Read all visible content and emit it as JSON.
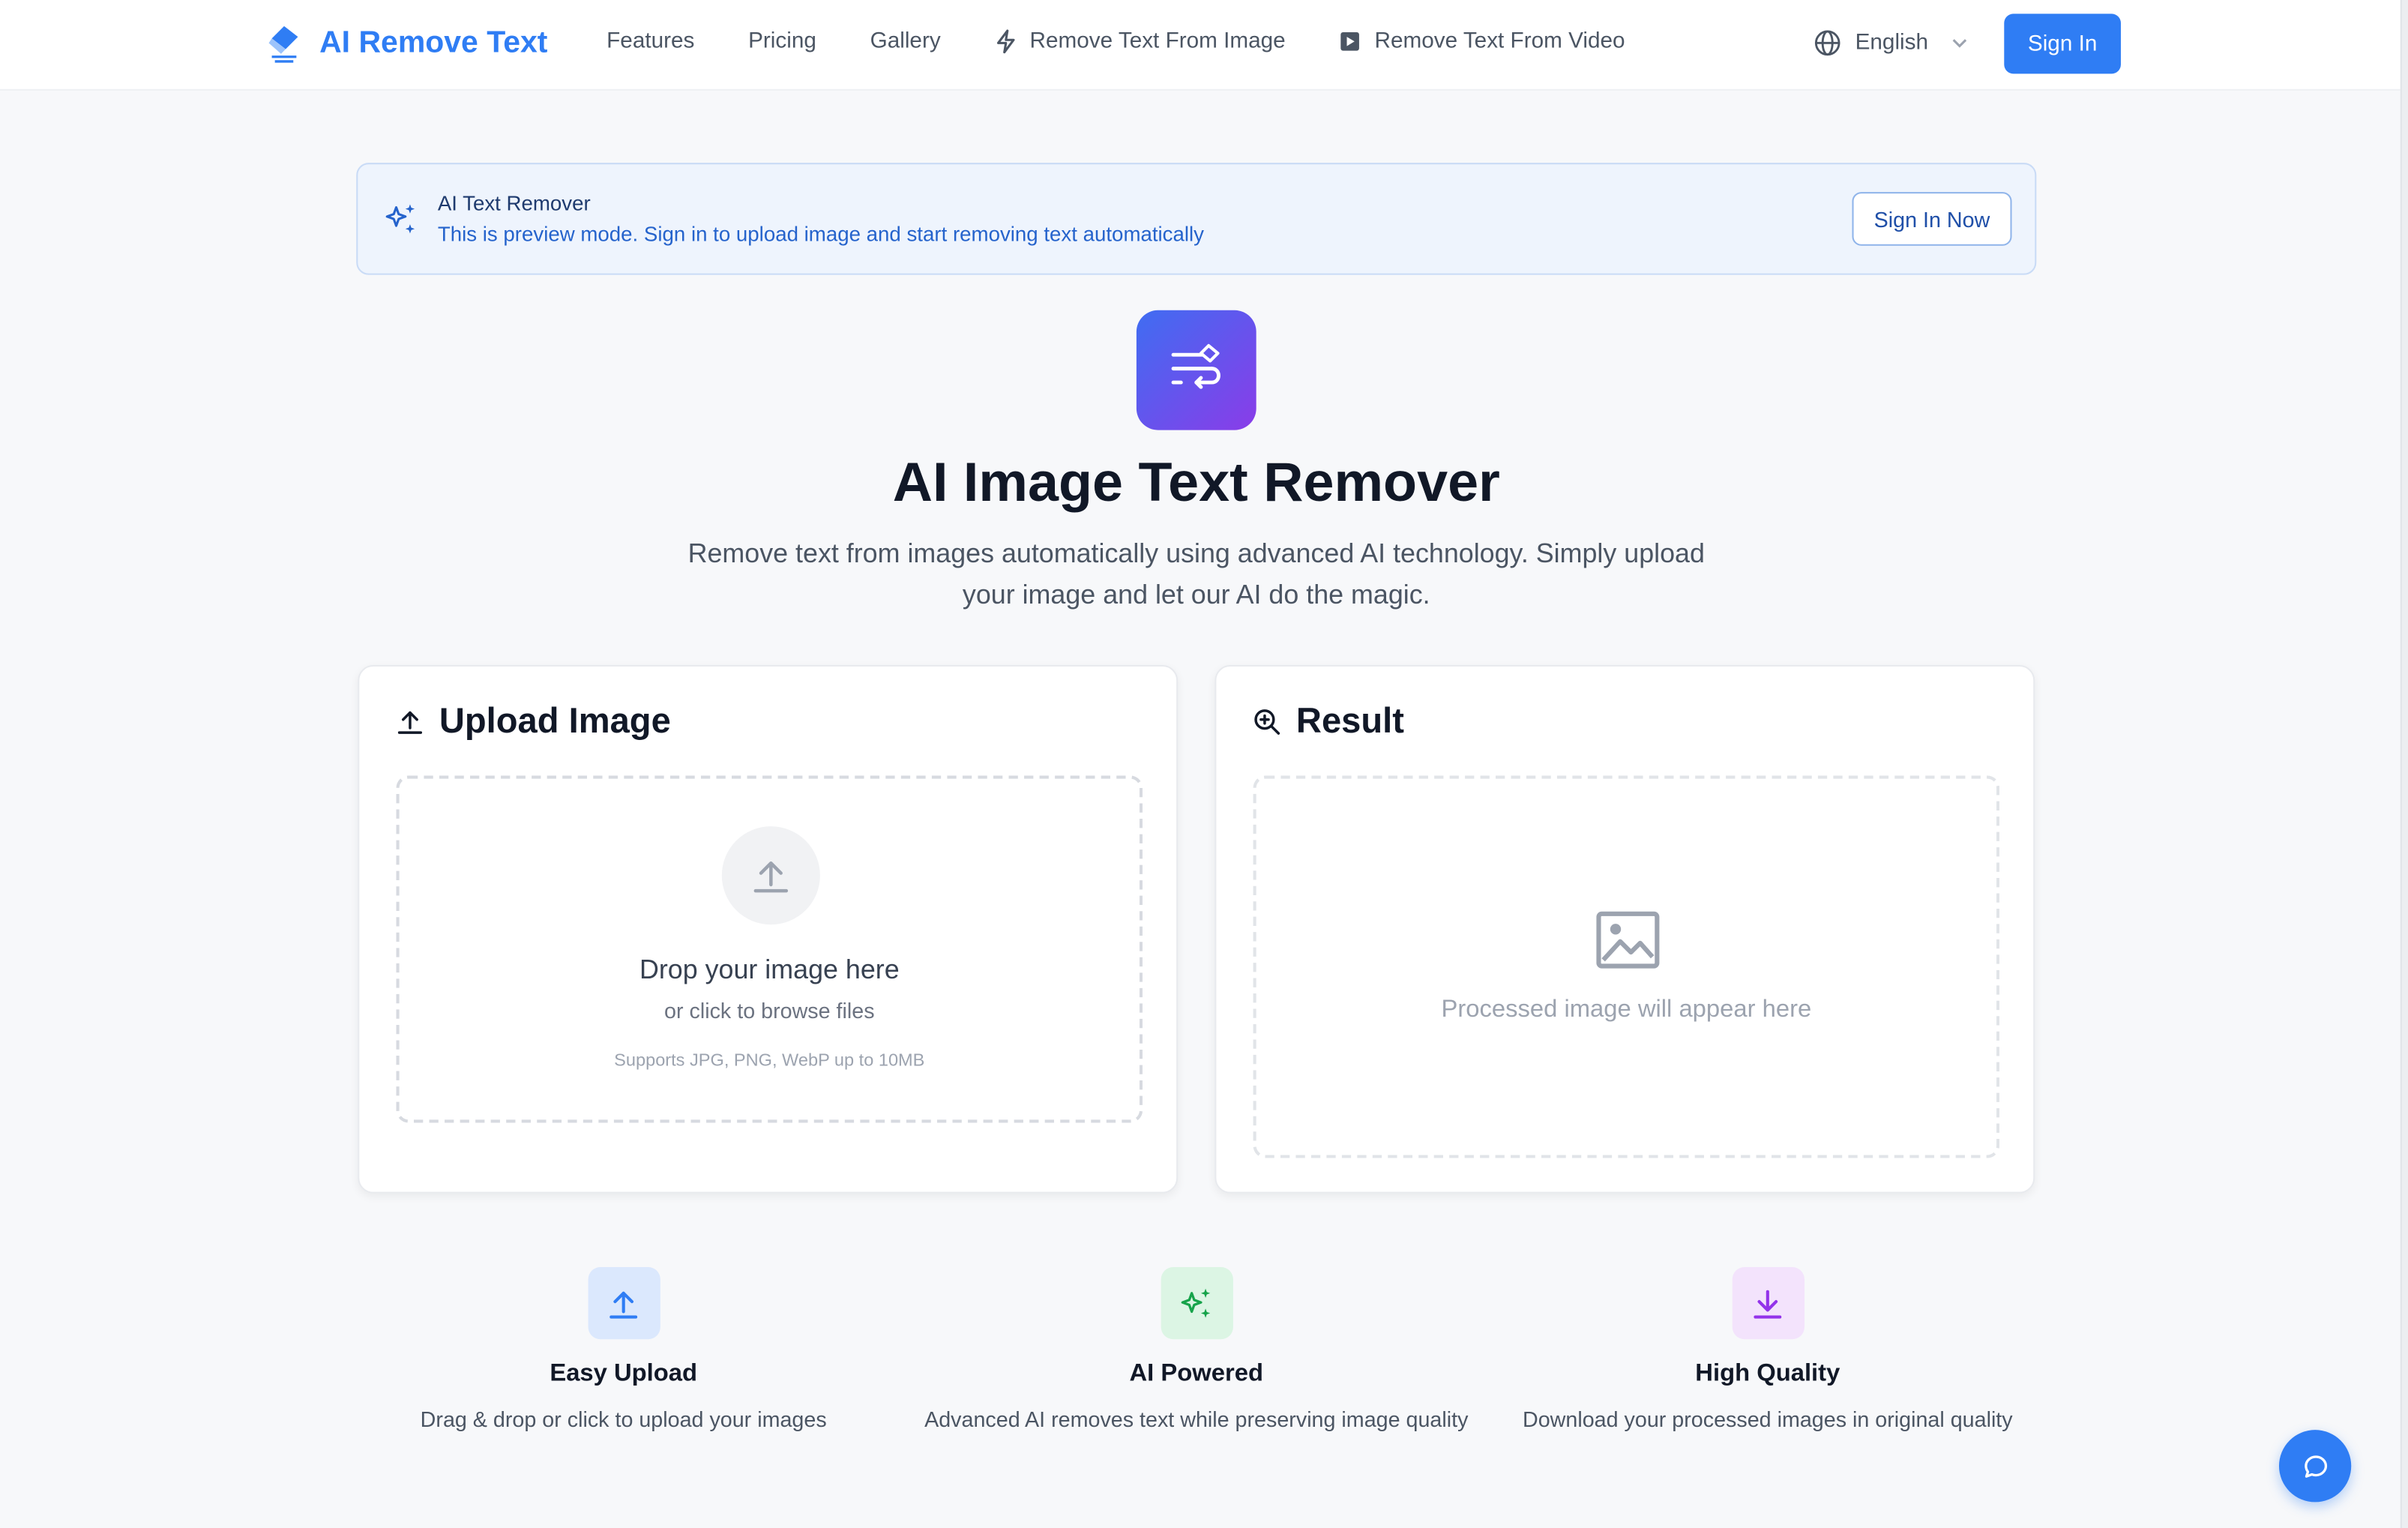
{
  "header": {
    "logo_text": "AI Remove Text",
    "nav": [
      {
        "label": "Features"
      },
      {
        "label": "Pricing"
      },
      {
        "label": "Gallery"
      },
      {
        "label": "Remove Text From Image",
        "icon": "bolt-icon"
      },
      {
        "label": "Remove Text From Video",
        "icon": "video-play-icon"
      }
    ],
    "language": "English",
    "signin_label": "Sign In"
  },
  "banner": {
    "title": "AI Text Remover",
    "message": "This is preview mode. Sign in to upload image and start removing text automatically",
    "button_label": "Sign In Now"
  },
  "hero": {
    "title": "AI Image Text Remover",
    "subtitle": "Remove text from images automatically using advanced AI technology. Simply upload your image and let our AI do the magic."
  },
  "upload": {
    "heading": "Upload Image",
    "drop_title": "Drop your image here",
    "drop_sub": "or click to browse files",
    "drop_hint": "Supports JPG, PNG, WebP up to 10MB"
  },
  "result": {
    "heading": "Result",
    "placeholder": "Processed image will appear here"
  },
  "features": [
    {
      "title": "Easy Upload",
      "desc": "Drag & drop or click to upload your images",
      "color": "#2f7df4"
    },
    {
      "title": "AI Powered",
      "desc": "Advanced AI removes text while preserving image quality",
      "color": "#16a34a"
    },
    {
      "title": "High Quality",
      "desc": "Download your processed images in original quality",
      "color": "#9333ea"
    }
  ],
  "colors": {
    "accent": "#2f7df4",
    "gradient_start": "#3f6df2",
    "gradient_end": "#8a3ce8"
  }
}
